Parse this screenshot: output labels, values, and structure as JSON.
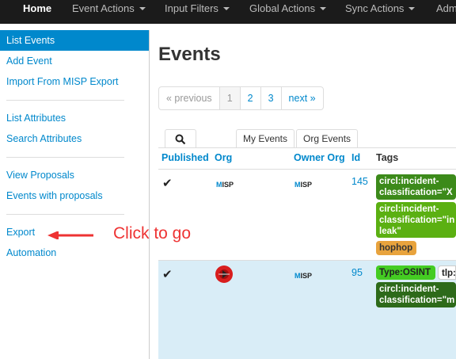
{
  "navbar": {
    "items": [
      {
        "label": "Home",
        "active": true
      },
      {
        "label": "Event Actions",
        "dropdown": true
      },
      {
        "label": "Input Filters",
        "dropdown": true
      },
      {
        "label": "Global Actions",
        "dropdown": true
      },
      {
        "label": "Sync Actions",
        "dropdown": true
      },
      {
        "label": "Adm"
      }
    ]
  },
  "sidebar": {
    "items": [
      {
        "label": "List Events",
        "active": true
      },
      {
        "label": "Add Event"
      },
      {
        "label": "Import From MISP Export"
      },
      {
        "label": "List Attributes"
      },
      {
        "label": "Search Attributes"
      },
      {
        "label": "View Proposals"
      },
      {
        "label": "Events with proposals"
      },
      {
        "label": "Export"
      },
      {
        "label": "Automation"
      }
    ]
  },
  "annotation": {
    "text": "Click to go",
    "color": "#ee3333"
  },
  "main": {
    "title": "Events",
    "pagination": [
      "« previous",
      "1",
      "2",
      "3",
      "next »"
    ],
    "tabs": {
      "search_icon": "search-icon",
      "my_events": "My Events",
      "org_events": "Org Events"
    },
    "columns": [
      "Published",
      "Org",
      "Owner Org",
      "Id",
      "Tags"
    ],
    "rows": [
      {
        "published": "✔",
        "org_logo": "MISP",
        "owner_org_logo": "MISP",
        "id": "145",
        "tags": [
          {
            "text": "circl:incident-\nclassification=\"X",
            "color": "#3c8a1a"
          },
          {
            "text": "circl:incident-\nclassification=\"in\nleak\"",
            "color": "#5bb012"
          },
          {
            "text": "hophop",
            "color": "#e8a33d",
            "text_color": "#333"
          }
        ]
      },
      {
        "published": "✔",
        "org_logo": "circl-logo",
        "owner_org_logo": "MISP",
        "id": "95",
        "tags": [
          {
            "text": "Type:OSINT",
            "color": "#44cc22",
            "text_color": "#222"
          },
          {
            "text": "tlp:",
            "color": "#ffffff",
            "text_color": "#222"
          },
          {
            "text": "circl:incident-\nclassification=\"m",
            "color": "#2d6a1a"
          }
        ]
      }
    ]
  },
  "colors": {
    "accent": "#0088cc",
    "navbar": "#1b1b1b",
    "selected_row": "#d9edf7"
  }
}
